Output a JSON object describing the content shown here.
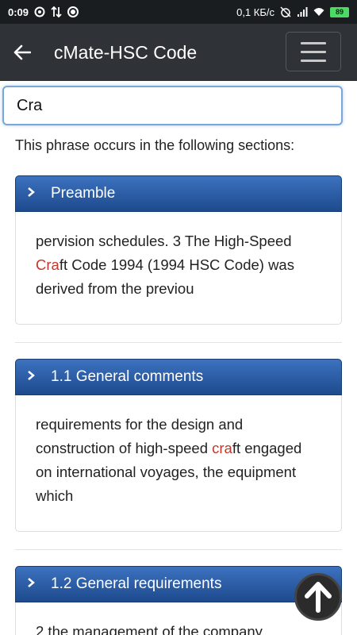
{
  "status_bar": {
    "time": "0:09",
    "network_speed": "0,1 КБ/с",
    "battery": "89"
  },
  "app_bar": {
    "title": "cMate-HSC Code"
  },
  "search": {
    "value": "Cra"
  },
  "intro_text": "This phrase occurs in the following sections:",
  "sections": [
    {
      "title": "Preamble",
      "snippet_before": "pervision schedules. 3 The High-Speed ",
      "match": "Cra",
      "snippet_after": "ft Code 1994 (1994 HSC Code) was derived from the previou"
    },
    {
      "title": "1.1 General comments",
      "snippet_before": "requirements for the design and construction of high-speed ",
      "match": "cra",
      "snippet_after": "ft engaged on international voyages, the equipment which"
    },
    {
      "title": "1.2 General requirements",
      "snippet_before": "2 the management of the company",
      "match": "",
      "snippet_after": ""
    }
  ],
  "colors": {
    "header_gradient_top": "#3c72bf",
    "header_gradient_bottom": "#1e4a8d",
    "highlight": "#c0392b",
    "app_bar": "#2f3338"
  }
}
